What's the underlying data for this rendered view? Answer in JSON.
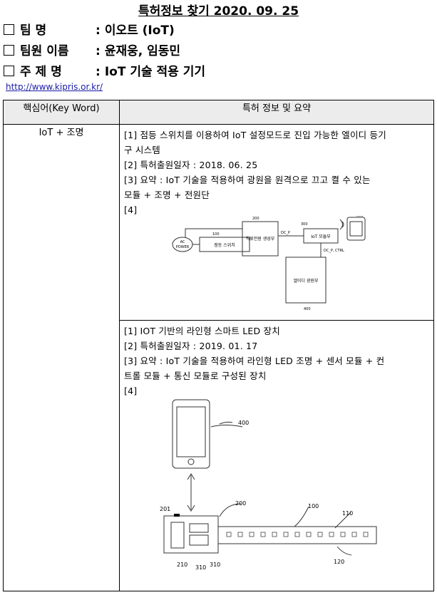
{
  "header": {
    "title": "특허정보 찾기 2020. 09. 25",
    "rows": [
      {
        "label": "팀 명",
        "value": "이오트 (IoT)"
      },
      {
        "label": "팀원 이름",
        "value": "윤재웅, 임동민"
      },
      {
        "label": "주 제 명",
        "value": "IoT 기술 적용 기기"
      }
    ],
    "separator": ":",
    "link": "http://www.kipris.or.kr/"
  },
  "table": {
    "col_keyword": "핵심어(Key Word)",
    "col_info": "특허 정보 및 요약",
    "keyword": "IoT + 조명",
    "patents": [
      {
        "lines": [
          "[1] 점등 스위치를 이용하여 IoT 설정모드로 진입 가능한 엘이디 등기",
          "구 시스템",
          "[2] 특허출원일자 : 2018. 06. 25",
          "[3] 요약 : IoT 기술을 적용하여 광원을 원격으로 끄고 켤 수 있는",
          "모듈 + 조명 + 전원단",
          "[4]"
        ],
        "diagram": {
          "ac_power": [
            "AC",
            "POWER"
          ],
          "switch": "점등 스위치",
          "power_gen": "직류전원 생성부",
          "iot_module": "IoT 모듈부",
          "led_driver": "엘이디 광원부",
          "dc_p": "DC_P",
          "dc_ctrl": "DC_P, CTRL",
          "n100": "100",
          "n200": "200",
          "n300": "300",
          "n400": "400",
          "n500": "500"
        }
      },
      {
        "lines": [
          "[1] IOT 기반의 라인형 스마트 LED 장치",
          "[2] 특허출원일자 : 2019. 01. 17",
          "[3] 요약 : IoT 기술을 적용하여 라인형 LED 조명 + 센서 모듈 + 컨",
          "트롤 모듈 + 통신 모듈로 구성된 장치",
          "[4]"
        ],
        "diagram": {
          "n400": "400",
          "n201": "201",
          "n200": "200",
          "n100": "100",
          "n110": "110",
          "n120": "120",
          "n210": "210",
          "n310a": "310",
          "n310b": "310"
        }
      }
    ]
  }
}
